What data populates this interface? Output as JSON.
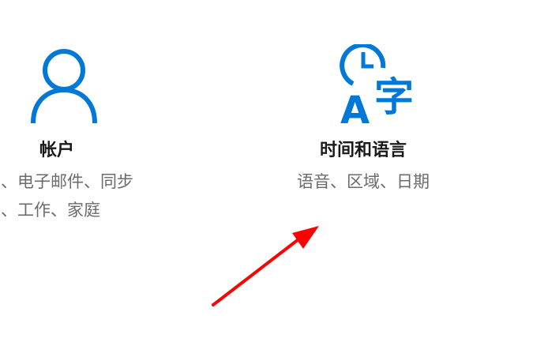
{
  "settings": {
    "accounts": {
      "icon": "user-icon",
      "title": "帐户",
      "description_line1": "户、电子邮件、同步",
      "description_line2": "置、工作、家庭"
    },
    "time_language": {
      "icon": "time-language-icon",
      "icon_text_letter": "A",
      "icon_text_char": "字",
      "title": "时间和语言",
      "description": "语音、区域、日期"
    }
  },
  "annotation": {
    "icon": "red-arrow-icon",
    "color": "#ff0000"
  },
  "colors": {
    "accent": "#0078d7",
    "title": "#1a1a1a",
    "description": "#6b6b6b",
    "background": "#ffffff"
  }
}
